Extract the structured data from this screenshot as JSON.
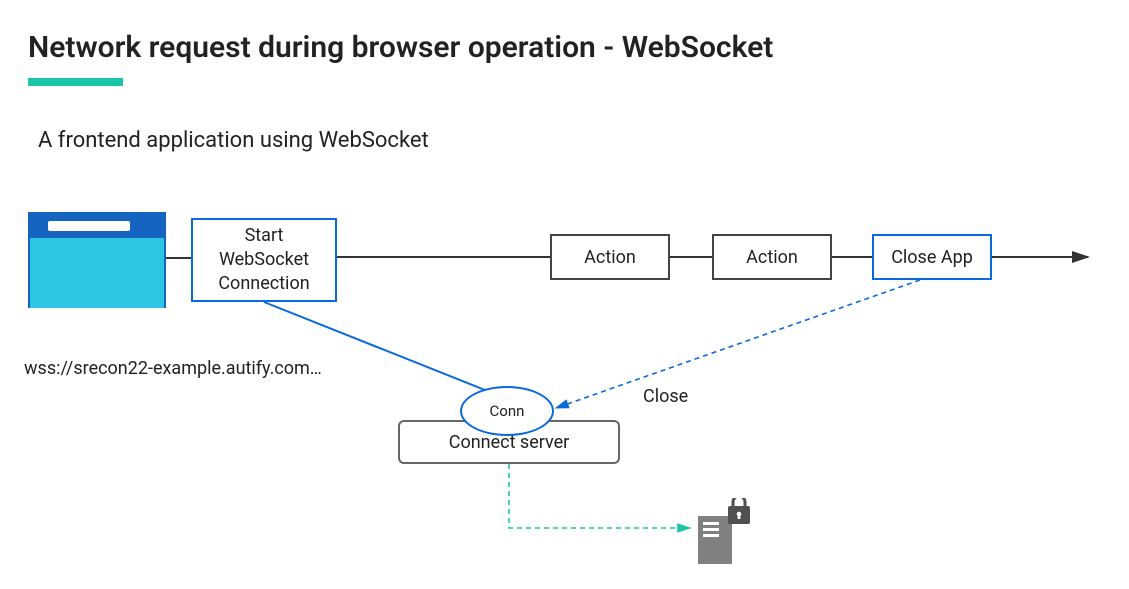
{
  "title": "Network request during browser operation - WebSocket",
  "subtitle": "A frontend application using WebSocket",
  "start_connection": "Start\nWebSocket\nConnection",
  "action1": "Action",
  "action2": "Action",
  "close_app": "Close App",
  "wss_url": "wss://srecon22-example.autify.com…",
  "conn": "Conn",
  "connect_server": "Connect server",
  "close_label": "Close"
}
